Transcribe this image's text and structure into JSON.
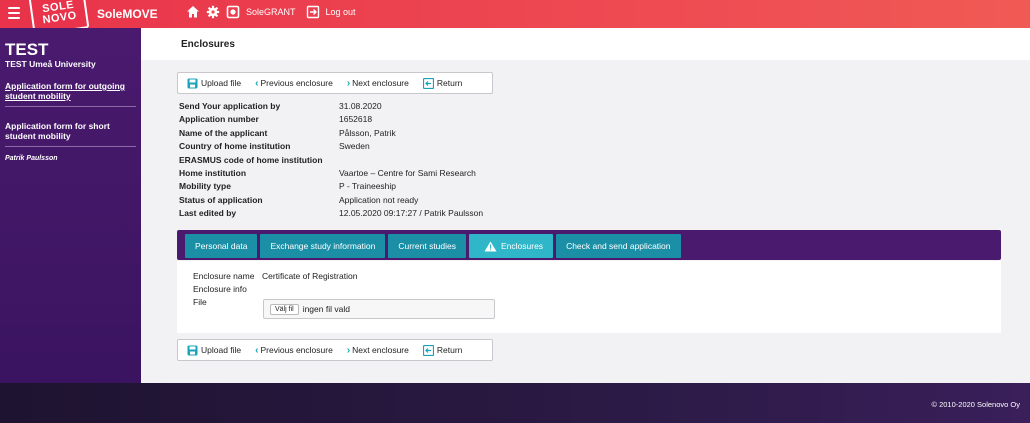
{
  "topbar": {
    "logo_line1": "SOLE",
    "logo_line2": "NOVO",
    "app_name": "SoleMOVE",
    "solegrant_label": "SoleGRANT",
    "logout_label": "Log out"
  },
  "sidebar": {
    "title": "TEST",
    "subtitle": "TEST Umeå University",
    "items": [
      {
        "label": "Application form for outgoing student mobility"
      },
      {
        "label": "Application form for short student mobility"
      }
    ],
    "user": "Patrik Paulsson"
  },
  "main": {
    "page_title": "Enclosures",
    "toolbar": {
      "upload": "Upload file",
      "previous": "Previous enclosure",
      "next": "Next enclosure",
      "return": "Return"
    },
    "info": [
      {
        "label": "Send Your application by",
        "value": "31.08.2020"
      },
      {
        "label": "Application number",
        "value": "1652618"
      },
      {
        "label": "Name of the applicant",
        "value": "Pålsson, Patrik"
      },
      {
        "label": "Country of home institution",
        "value": "Sweden"
      },
      {
        "label": "ERASMUS code of home institution",
        "value": ""
      },
      {
        "label": "Home institution",
        "value": "Vaartoe – Centre for Sami Research"
      },
      {
        "label": "Mobility type",
        "value": "P - Traineeship"
      },
      {
        "label": "Status of application",
        "value": "Application not ready"
      },
      {
        "label": "Last edited by",
        "value": "12.05.2020 09:17:27 / Patrik Paulsson"
      }
    ],
    "tabs": [
      {
        "label": "Personal data"
      },
      {
        "label": "Exchange study information"
      },
      {
        "label": "Current studies"
      },
      {
        "label": "Enclosures"
      },
      {
        "label": "Check and send application"
      }
    ],
    "enclosure": {
      "name_label": "Enclosure name",
      "name_value": "Certificate of Registration",
      "info_label": "Enclosure info",
      "file_label": "File",
      "choose_button": "Välj fil",
      "no_file": "ingen fil vald"
    }
  },
  "footer": {
    "copyright": "© 2010-2020   Solenovo Oy"
  },
  "colors": {
    "topbar": "#e8334a",
    "sidebar": "#4a1a6e",
    "tab": "#1b8fa6",
    "tab_active": "#2fb6c8"
  }
}
